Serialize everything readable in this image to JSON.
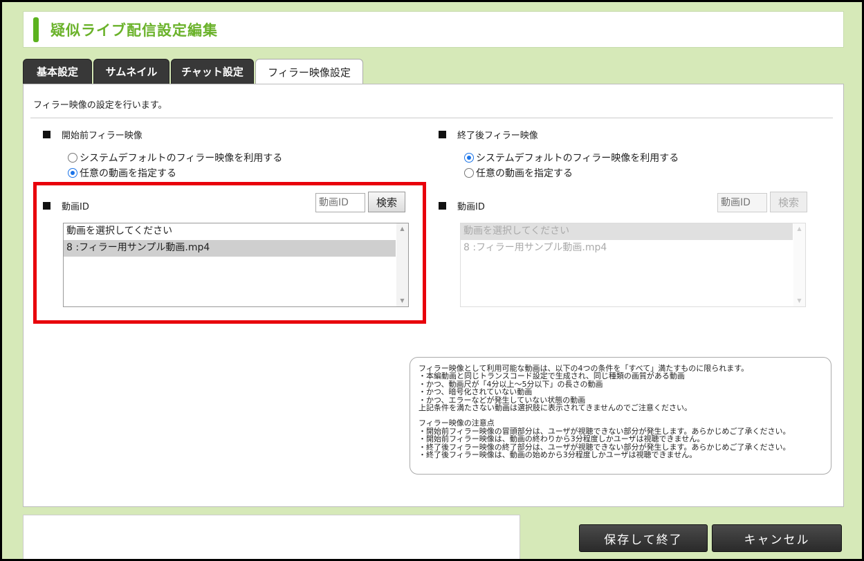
{
  "header": {
    "title": "疑似ライブ配信設定編集"
  },
  "tabs": [
    {
      "label": "基本設定"
    },
    {
      "label": "サムネイル"
    },
    {
      "label": "チャット設定"
    },
    {
      "label": "フィラー映像設定"
    }
  ],
  "panel": {
    "description": "フィラー映像の設定を行います。"
  },
  "before": {
    "title": "開始前フィラー映像",
    "radio_default": "システムデフォルトのフィラー映像を利用する",
    "radio_custom": "任意の動画を指定する",
    "selected": "custom",
    "id_label": "動画ID",
    "id_placeholder": "動画ID",
    "search_label": "検索",
    "options": [
      "動画を選択してください",
      "8 :フィラー用サンプル動画.mp4"
    ]
  },
  "after": {
    "title": "終了後フィラー映像",
    "radio_default": "システムデフォルトのフィラー映像を利用する",
    "radio_custom": "任意の動画を指定する",
    "selected": "default",
    "id_label": "動画ID",
    "id_placeholder": "動画ID",
    "search_label": "検索",
    "options": [
      "動画を選択してください",
      "8 :フィラー用サンプル動画.mp4"
    ]
  },
  "note": {
    "lines": [
      "フィラー映像として利用可能な動画は、以下の4つの条件を「すべて」満たすものに限られます。",
      "・本編動画と同じトランスコード設定で生成され、同じ種類の画質がある動画",
      "・かつ、動画尺が「4分以上～5分以下」の長さの動画",
      "・かつ、暗号化されていない動画",
      "・かつ、エラーなどが発生していない状態の動画",
      "上記条件を満たさない動画は選択肢に表示されてきませんのでご注意ください。"
    ],
    "lines2": [
      "フィラー映像の注意点",
      "・開始前フィラー映像の冒頭部分は、ユーザが視聴できない部分が発生します。あらかじめご了承ください。",
      "・開始前フィラー映像は、動画の終わりから3分程度しかユーザは視聴できません。",
      "・終了後フィラー映像の終了部分は、ユーザが視聴できない部分が発生します。あらかじめご了承ください。",
      "・終了後フィラー映像は、動画の始めから3分程度しかユーザは視聴できません。"
    ]
  },
  "footer": {
    "save_label": "保存して終了",
    "cancel_label": "キャンセル"
  }
}
